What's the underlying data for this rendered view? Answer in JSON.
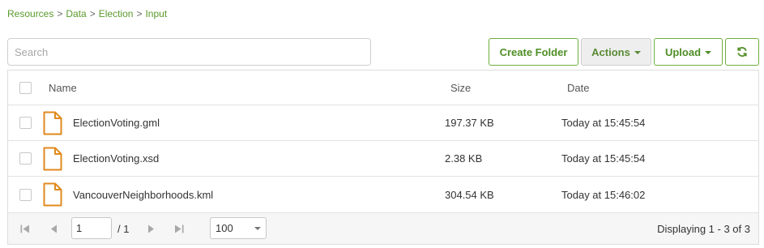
{
  "breadcrumb": {
    "items": [
      "Resources",
      "Data",
      "Election",
      "Input"
    ],
    "separator": ">"
  },
  "search": {
    "placeholder": "Search",
    "value": ""
  },
  "toolbar": {
    "create_folder_label": "Create Folder",
    "actions_label": "Actions",
    "upload_label": "Upload",
    "refresh_icon": "refresh-icon"
  },
  "table": {
    "headers": {
      "name": "Name",
      "size": "Size",
      "date": "Date"
    },
    "rows": [
      {
        "name": "ElectionVoting.gml",
        "size": "197.37 KB",
        "date": "Today at 15:45:54"
      },
      {
        "name": "ElectionVoting.xsd",
        "size": "2.38 KB",
        "date": "Today at 15:45:54"
      },
      {
        "name": "VancouverNeighborhoods.kml",
        "size": "304.54 KB",
        "date": "Today at 15:46:02"
      }
    ]
  },
  "pagination": {
    "current_page": "1",
    "total_pages": "/ 1",
    "per_page": "100",
    "display_text": "Displaying 1 - 3 of 3"
  },
  "colors": {
    "accent_green": "#5a9a2b",
    "file_icon_orange": "#e08a1e"
  }
}
